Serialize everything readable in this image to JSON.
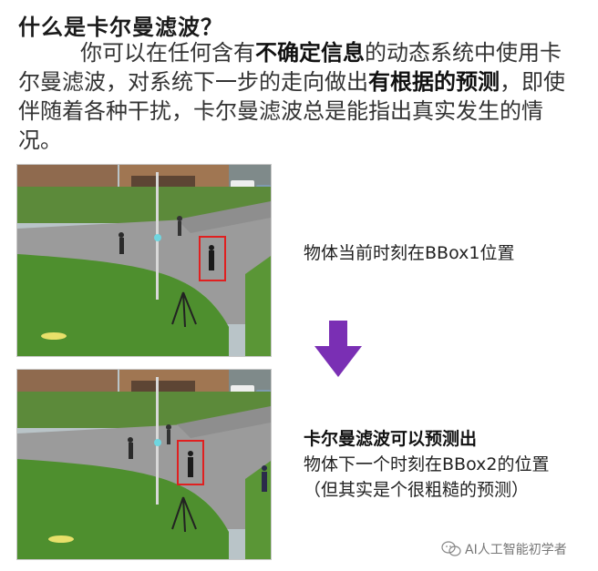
{
  "title": "什么是卡尔曼滤波？",
  "intro": {
    "part1": "你可以在任何含有",
    "bold1": "不确定信息",
    "part2": "的动态系统中使用卡尔曼滤波，对系统下一步的走向做出",
    "bold2": "有根据的预测",
    "part3": "，即使伴随着各种干扰，卡尔曼滤波总是能指出真实发生的情况。"
  },
  "frame1": {
    "caption": "物体当前时刻在BBox1位置"
  },
  "frame2": {
    "caption_line1": "卡尔曼滤波可以预测出",
    "caption_line2": "物体下一个时刻在BBox2的位置",
    "caption_line3": "（但其实是个很粗糙的预测）"
  },
  "watermark": {
    "text": "AI人工智能初学者",
    "icon": "wechat-icon"
  },
  "colors": {
    "bbox": "#e02020",
    "arrow": "#7a2fb4",
    "grass": "#4e8f2e",
    "road": "#9a9a9a"
  }
}
